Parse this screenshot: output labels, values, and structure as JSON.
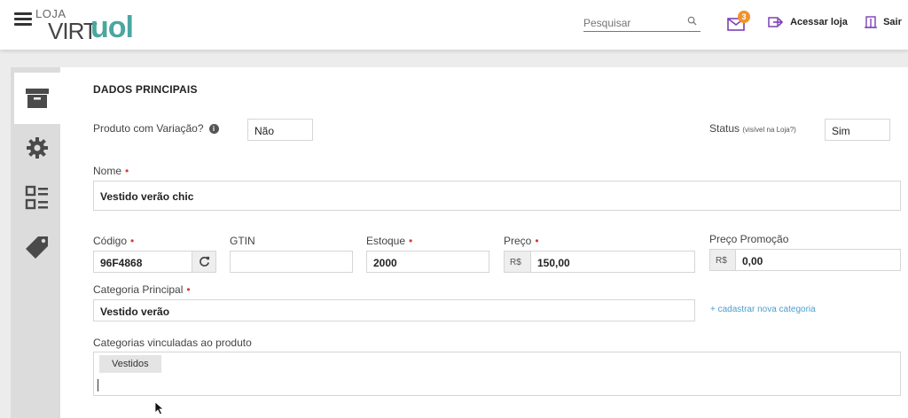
{
  "header": {
    "logo_small": "LOJA",
    "logo_virt": "VIRT",
    "logo_uol": "uol",
    "search_placeholder": "Pesquisar",
    "mail_count": "3",
    "access_store": "Acessar loja",
    "logout": "Sair"
  },
  "sidebar": {
    "items": [
      {
        "icon": "box-icon",
        "active": true
      },
      {
        "icon": "gear-icon",
        "active": false
      },
      {
        "icon": "dashboard-icon",
        "active": false
      },
      {
        "icon": "tag-icon",
        "active": false
      }
    ]
  },
  "form": {
    "section_title": "DADOS PRINCIPAIS",
    "variation_label": "Produto com Variação?",
    "variation_value": "Não",
    "status_label": "Status",
    "status_sub": "(visível na Loja?)",
    "status_value": "Sim",
    "name_label": "Nome",
    "name_value": "Vestido verão chic",
    "code_label": "Código",
    "code_value": "96F4868",
    "gtin_label": "GTIN",
    "gtin_value": "",
    "stock_label": "Estoque",
    "stock_value": "2000",
    "price_label": "Preço",
    "currency": "R$",
    "price_value": "150,00",
    "promo_label": "Preço Promoção",
    "promo_value": "0,00",
    "category_label": "Categoria Principal",
    "category_value": "Vestido verão",
    "new_category_link": "+ cadastrar nova categoria",
    "linked_label": "Categorias vinculadas ao produto",
    "linked_chips": [
      "Vestidos"
    ]
  },
  "colors": {
    "brand": "#4ba6a0",
    "badge": "#f0932b",
    "required": "#d43b3b",
    "link": "#4a9ed0",
    "icon_purple": "#7b3fb5"
  }
}
